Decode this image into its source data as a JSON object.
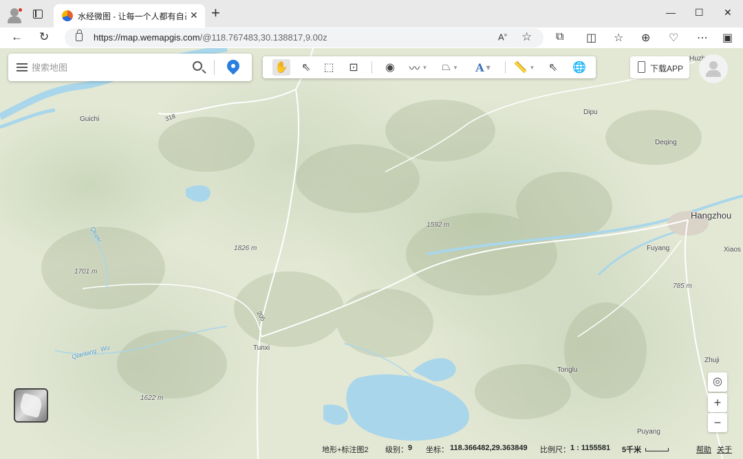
{
  "browser": {
    "tab_title": "水经微图 - 让每一个人都有自己的",
    "url_main": "https://map.wemapgis.com",
    "url_rest": "/@118.767483,30.138817,9.00z",
    "read_aloud": "A",
    "new_tab": "+",
    "window_controls": {
      "minimize": "—",
      "maximize": "☐",
      "close": "✕"
    }
  },
  "search": {
    "placeholder": "搜索地图"
  },
  "toolbar": {
    "download_label": "下载APP"
  },
  "map": {
    "places": [
      {
        "name": "Guichi",
        "kind": "town"
      },
      {
        "name": "Dipu",
        "kind": "town"
      },
      {
        "name": "Deqing",
        "kind": "town"
      },
      {
        "name": "Hangzhou",
        "kind": "city"
      },
      {
        "name": "Fuyang",
        "kind": "town"
      },
      {
        "name": "Xiaos",
        "kind": "town"
      },
      {
        "name": "Tunxi",
        "kind": "town"
      },
      {
        "name": "Tonglu",
        "kind": "town"
      },
      {
        "name": "Zhuji",
        "kind": "town"
      },
      {
        "name": "Puyang",
        "kind": "town"
      },
      {
        "name": "Huzhou",
        "kind": "town"
      }
    ],
    "elevations": [
      "1592 m",
      "1826 m",
      "1701 m",
      "785 m",
      "1622 m"
    ],
    "waters": [
      "Qiupu",
      "Qiantang",
      "Wu"
    ],
    "roads": [
      "318",
      "205"
    ]
  },
  "status": {
    "layer": "地形+标注图2",
    "level_label": "级别：",
    "level_value": "9",
    "coord_label": "坐标：",
    "coord_value": "118.366482,29.363849",
    "scale_label": "比例尺：",
    "scale_value": "1 : 1155581",
    "scale_bar": "5千米",
    "help": "帮助",
    "about": "关于"
  },
  "colors": {
    "accent": "#2a7ee0",
    "water": "#a9d6ea",
    "land": "#e3e8d5"
  }
}
